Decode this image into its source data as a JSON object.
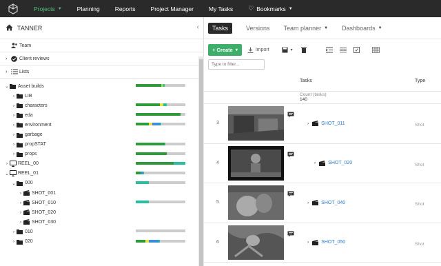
{
  "topnav": {
    "items": [
      {
        "label": "Projects",
        "active": true,
        "dropdown": true
      },
      {
        "label": "Planning"
      },
      {
        "label": "Reports"
      },
      {
        "label": "Project Manager"
      },
      {
        "label": "My Tasks"
      },
      {
        "label": "Bookmarks",
        "dropdown": true
      }
    ]
  },
  "sidebar": {
    "project_name": "TANNER",
    "sections": [
      {
        "label": "Team",
        "icon": "users-icon"
      },
      {
        "label": "Client reviews",
        "icon": "check-circle-icon"
      },
      {
        "label": "Lists",
        "icon": "list-icon"
      }
    ],
    "tree": [
      {
        "label": "Asset builds",
        "icon": "folder-icon",
        "expanded": true,
        "indent": 0,
        "progress": [
          {
            "c": "#2e9b3a",
            "v": 0.52
          },
          {
            "c": "#aad54a",
            "v": 0.04
          },
          {
            "c": "#26bfa0",
            "v": 0.02
          }
        ]
      },
      {
        "label": "LIB",
        "icon": "folder-icon",
        "indent": 1
      },
      {
        "label": "characters",
        "icon": "folder-icon",
        "indent": 1,
        "progress": [
          {
            "c": "#2e9b3a",
            "v": 0.48
          },
          {
            "c": "#e6e14a",
            "v": 0.08
          },
          {
            "c": "#26bfa0",
            "v": 0.06
          }
        ]
      },
      {
        "label": "eda",
        "icon": "folder-icon",
        "indent": 1,
        "progress": [
          {
            "c": "#2e9b3a",
            "v": 0.9
          }
        ]
      },
      {
        "label": "environment",
        "icon": "folder-icon",
        "indent": 1,
        "progress": [
          {
            "c": "#2e9b3a",
            "v": 0.26
          },
          {
            "c": "#e6e14a",
            "v": 0.08
          },
          {
            "c": "#3c8fd6",
            "v": 0.14
          },
          {
            "c": "#26bfa0",
            "v": 0.04
          }
        ]
      },
      {
        "label": "garbage",
        "icon": "folder-icon",
        "indent": 1
      },
      {
        "label": "propSTAT",
        "icon": "folder-icon",
        "indent": 1,
        "progress": [
          {
            "c": "#2e9b3a",
            "v": 0.58
          },
          {
            "c": "#26bfa0",
            "v": 0.02
          }
        ]
      },
      {
        "label": "props",
        "icon": "folder-icon",
        "indent": 1,
        "progress": [
          {
            "c": "#2e9b3a",
            "v": 0.62
          }
        ]
      },
      {
        "label": "REEL_00",
        "icon": "monitor-icon",
        "indent": 0,
        "progress": [
          {
            "c": "#2e9b3a",
            "v": 0.76
          },
          {
            "c": "#26bfa0",
            "v": 0.24
          }
        ]
      },
      {
        "label": "REEL_01",
        "icon": "monitor-icon",
        "expanded": true,
        "indent": 0,
        "progress": [
          {
            "c": "#2e9b3a",
            "v": 0.1
          },
          {
            "c": "#3c8fd6",
            "v": 0.04
          },
          {
            "c": "#26bfa0",
            "v": 0.02
          }
        ]
      },
      {
        "label": "000",
        "icon": "folder-icon",
        "expanded": true,
        "indent": 1,
        "progress": [
          {
            "c": "#26bfa0",
            "v": 0.26
          }
        ]
      },
      {
        "label": "SHOT_001",
        "icon": "clapper-icon",
        "indent": 2
      },
      {
        "label": "SHOT_010",
        "icon": "clapper-icon",
        "indent": 2,
        "progress": [
          {
            "c": "#26bfa0",
            "v": 0.26
          }
        ]
      },
      {
        "label": "SHOT_020",
        "icon": "clapper-icon",
        "indent": 2
      },
      {
        "label": "SHOT_030",
        "icon": "clapper-icon",
        "indent": 2
      },
      {
        "label": "010",
        "icon": "folder-icon",
        "indent": 1,
        "progress": []
      },
      {
        "label": "020",
        "icon": "folder-icon",
        "indent": 1,
        "progress": [
          {
            "c": "#2e9b3a",
            "v": 0.2
          },
          {
            "c": "#e6e14a",
            "v": 0.06
          },
          {
            "c": "#3c8fd6",
            "v": 0.2
          },
          {
            "c": "#26bfa0",
            "v": 0.02
          }
        ]
      }
    ]
  },
  "main": {
    "tabs": [
      {
        "label": "Tasks",
        "active": true
      },
      {
        "label": "Versions"
      },
      {
        "label": "Team planner",
        "dropdown": true
      },
      {
        "label": "Dashboards",
        "dropdown": true
      }
    ],
    "toolbar": {
      "create_label": "+ Create",
      "import_label": "Import"
    },
    "filter_placeholder": "Type to filter...",
    "table": {
      "col_tasks": "Tasks",
      "col_type": "Type",
      "count_label": "Count (tasks)",
      "count_value": "140",
      "rows": [
        {
          "num": "3",
          "shot": "SHOT_011",
          "type": "Shot",
          "indent": 0
        },
        {
          "num": "4",
          "shot": "SHOT_020",
          "type": "Shot",
          "indent": 1
        },
        {
          "num": "5",
          "shot": "SHOT_040",
          "type": "Shot",
          "indent": 0
        },
        {
          "num": "6",
          "shot": "SHOT_050",
          "type": "Shot",
          "indent": 0
        }
      ]
    }
  }
}
